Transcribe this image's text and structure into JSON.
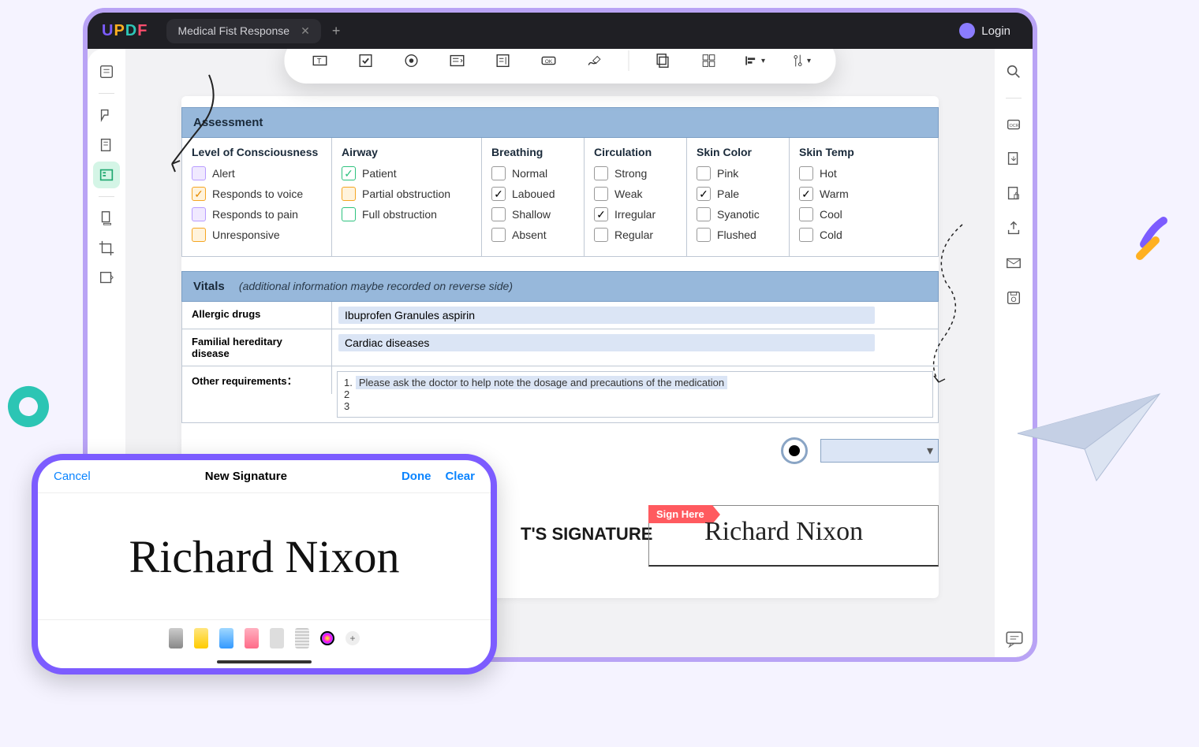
{
  "titlebar": {
    "tab": "Medical Fist Response",
    "login": "Login"
  },
  "assessment": {
    "header": "Assessment",
    "cols": [
      {
        "title": "Level of Consciousness",
        "items": [
          {
            "label": "Alert",
            "style": "purple",
            "checked": false
          },
          {
            "label": "Responds to voice",
            "style": "orange",
            "checked": true
          },
          {
            "label": "Responds to pain",
            "style": "purple",
            "checked": false
          },
          {
            "label": "Unresponsive",
            "style": "orange",
            "checked": false
          }
        ]
      },
      {
        "title": "Airway",
        "items": [
          {
            "label": "Patient",
            "style": "green",
            "checked": true
          },
          {
            "label": "Partial obstruction",
            "style": "orange",
            "checked": false
          },
          {
            "label": "Full obstruction",
            "style": "green",
            "checked": false
          }
        ]
      },
      {
        "title": "Breathing",
        "items": [
          {
            "label": "Normal",
            "style": "plain",
            "checked": false
          },
          {
            "label": "Laboued",
            "style": "black",
            "checked": true
          },
          {
            "label": "Shallow",
            "style": "plain",
            "checked": false
          },
          {
            "label": "Absent",
            "style": "plain",
            "checked": false
          }
        ]
      },
      {
        "title": "Circulation",
        "items": [
          {
            "label": "Strong",
            "style": "plain",
            "checked": false
          },
          {
            "label": "Weak",
            "style": "plain",
            "checked": false
          },
          {
            "label": "Irregular",
            "style": "black",
            "checked": true
          },
          {
            "label": "Regular",
            "style": "plain",
            "checked": false
          }
        ]
      },
      {
        "title": "Skin Color",
        "items": [
          {
            "label": "Pink",
            "style": "plain",
            "checked": false
          },
          {
            "label": "Pale",
            "style": "black",
            "checked": true
          },
          {
            "label": "Syanotic",
            "style": "plain",
            "checked": false
          },
          {
            "label": "Flushed",
            "style": "plain",
            "checked": false
          }
        ]
      },
      {
        "title": "Skin Temp",
        "items": [
          {
            "label": "Hot",
            "style": "plain",
            "checked": false
          },
          {
            "label": "Warm",
            "style": "black",
            "checked": true
          },
          {
            "label": "Cool",
            "style": "plain",
            "checked": false
          },
          {
            "label": "Cold",
            "style": "plain",
            "checked": false
          }
        ]
      }
    ]
  },
  "vitals": {
    "header": "Vitals",
    "hint": "(additional information maybe recorded on reverse side)",
    "allergic_label": "Allergic drugs",
    "allergic_value": "Ibuprofen Granules  aspirin",
    "familial_label": "Familial hereditary disease",
    "familial_value": "Cardiac diseases",
    "other_label": "Other requirements：",
    "req1": "Please ask the doctor to help note the dosage and precautions of the medication",
    "req2": "2",
    "req3": "3"
  },
  "signature": {
    "label": "T'S SIGNATURE",
    "sign_here": "Sign Here",
    "value": "Richard Nixon"
  },
  "phone": {
    "cancel": "Cancel",
    "title": "New Signature",
    "done": "Done",
    "clear": "Clear",
    "sig": "Richard Nixon"
  }
}
